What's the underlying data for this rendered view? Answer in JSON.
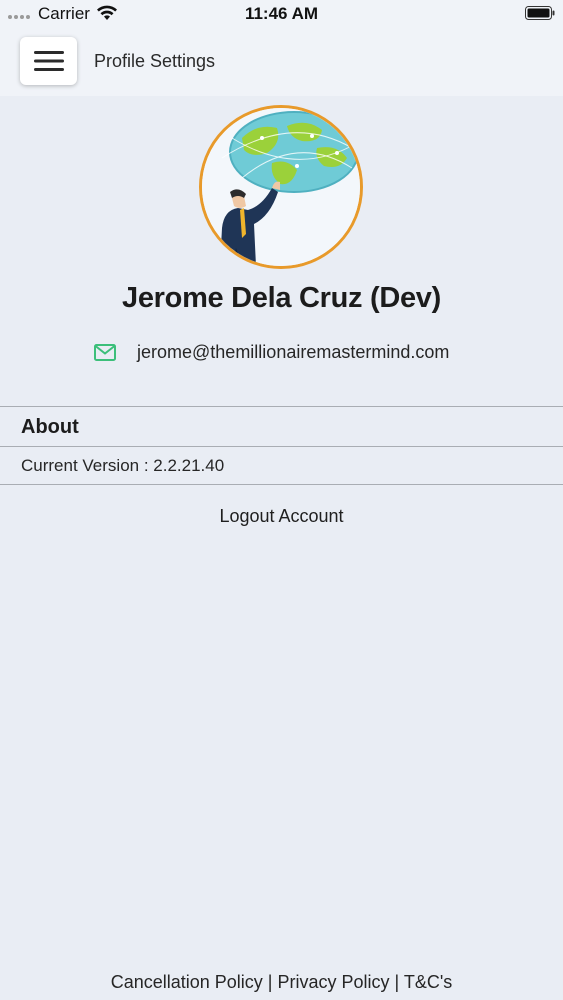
{
  "status_bar": {
    "carrier": "Carrier",
    "time": "11:46 AM"
  },
  "header": {
    "menu_icon": "hamburger-menu-icon",
    "title": "Profile Settings"
  },
  "profile": {
    "avatar_icon": "globe-businessman-avatar",
    "name": "Jerome Dela Cruz (Dev)",
    "email_icon": "mail-icon",
    "email": "jerome@themillionairemastermind.com"
  },
  "about": {
    "title": "About",
    "version_text": "Current Version : 2.2.21.40"
  },
  "logout_label": "Logout Account",
  "footer": {
    "cancellation": "Cancellation Policy",
    "separator": " | ",
    "privacy": "Privacy Policy",
    "terms": "T&C's"
  },
  "colors": {
    "background": "#e9edf4",
    "avatar_border": "#e89a2a",
    "mail_icon": "#3cbf7a"
  }
}
